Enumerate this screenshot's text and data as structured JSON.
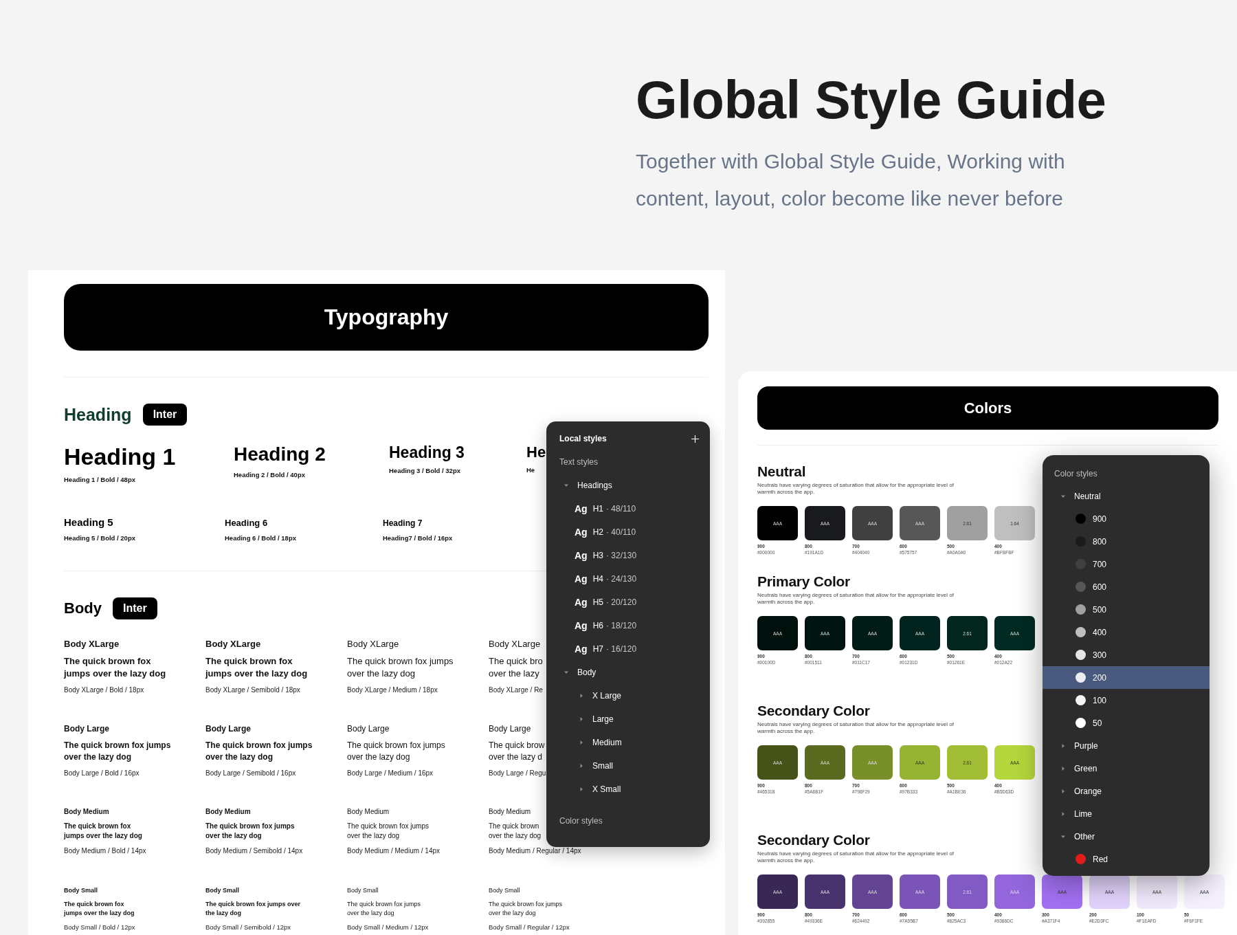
{
  "header": {
    "title": "Global Style Guide",
    "subtitle": "Together with Global Style Guide, Working with content, layout, color become like never before"
  },
  "typography": {
    "title": "Typography",
    "heading_section": {
      "label": "Heading",
      "font": "Inter",
      "rows": [
        [
          {
            "kind": "h1",
            "name": "Heading 1",
            "spec": "Heading 1 / Bold / 48px"
          },
          {
            "kind": "h2",
            "name": "Heading 2",
            "spec": "Heading 2 / Bold / 40px"
          },
          {
            "kind": "h3",
            "name": "Heading 3",
            "spec": "Heading 3 / Bold / 32px"
          },
          {
            "kind": "h4",
            "name": "He",
            "spec": "He"
          }
        ],
        [
          {
            "kind": "h5",
            "name": "Heading 5",
            "spec": "Heading 5 / Bold / 20px"
          },
          {
            "kind": "h6",
            "name": "Heading 6",
            "spec": "Heading 6 / Bold / 18px"
          },
          {
            "kind": "h7",
            "name": "Heading 7",
            "spec": "Heading7 / Bold / 16px"
          }
        ]
      ]
    },
    "body_section": {
      "label": "Body",
      "font": "Inter",
      "rows": [
        {
          "kind": "xlarge",
          "cells": [
            {
              "title": "Body XLarge",
              "sample": "The quick brown fox\njumps over the lazy dog",
              "spec": "Body XLarge / Bold / 18px"
            },
            {
              "title": "Body XLarge",
              "sample": "The quick brown fox\njumps over the lazy dog",
              "spec": "Body XLarge / Semibold / 18px"
            },
            {
              "title": "Body XLarge",
              "sample": "The quick brown fox jumps\nover the lazy dog",
              "spec": "Body XLarge / Medium / 18px"
            },
            {
              "title": "Body XLarge",
              "sample": "The quick bro\nover the lazy",
              "spec": "Body XLarge / Re"
            }
          ]
        },
        {
          "kind": "large",
          "cells": [
            {
              "title": "Body Large",
              "sample": "The quick brown fox jumps\nover the lazy dog",
              "spec": "Body Large / Bold / 16px"
            },
            {
              "title": "Body Large",
              "sample": "The quick brown fox jumps\nover the lazy dog",
              "spec": "Body Large / Semibold / 16px"
            },
            {
              "title": "Body Large",
              "sample": "The quick brown fox jumps\nover the lazy dog",
              "spec": "Body Large / Medium / 16px"
            },
            {
              "title": "Body Large",
              "sample": "The quick brow\nover the lazy d",
              "spec": "Body Large / Regu"
            }
          ]
        },
        {
          "kind": "medium",
          "cells": [
            {
              "title": "Body Medium",
              "sample": "The quick brown fox\njumps over the lazy dog",
              "spec": "Body Medium / Bold / 14px"
            },
            {
              "title": "Body Medium",
              "sample": "The quick brown fox jumps\nover the lazy dog",
              "spec": "Body Medium / Semibold / 14px"
            },
            {
              "title": "Body Medium",
              "sample": "The quick brown fox jumps\nover the lazy dog",
              "spec": "Body Medium / Medium / 14px"
            },
            {
              "title": "Body Medium",
              "sample": "The quick brown\nover the lazy dog",
              "spec": "Body Medium / Regular / 14px"
            }
          ]
        },
        {
          "kind": "small",
          "cells": [
            {
              "title": "Body Small",
              "sample": "The quick brown fox\njumps over the lazy dog",
              "spec": "Body Small / Bold / 12px"
            },
            {
              "title": "Body Small",
              "sample": "The quick brown fox jumps over\nthe lazy dog",
              "spec": "Body Small / Semibold / 12px"
            },
            {
              "title": "Body Small",
              "sample": "The quick brown fox jumps\nover the lazy dog",
              "spec": "Body Small / Medium / 12px"
            },
            {
              "title": "Body Small",
              "sample": "The quick brown fox jumps\nover the lazy dog",
              "spec": "Body Small / Regular / 12px"
            }
          ]
        }
      ]
    }
  },
  "local_styles": {
    "title": "Local styles",
    "sections": [
      {
        "label": "Text styles",
        "groups": [
          {
            "label": "Headings",
            "expanded": true,
            "items": [
              {
                "kind": "text-style",
                "sample": "Ag",
                "name": "H1",
                "size": "· 48/110"
              },
              {
                "kind": "text-style",
                "sample": "Ag",
                "name": "H2",
                "size": "· 40/110"
              },
              {
                "kind": "text-style",
                "sample": "Ag",
                "name": "H3",
                "size": "· 32/130"
              },
              {
                "kind": "text-style",
                "sample": "Ag",
                "name": "H4",
                "size": "· 24/130"
              },
              {
                "kind": "text-style",
                "sample": "Ag",
                "name": "H5",
                "size": "· 20/120"
              },
              {
                "kind": "text-style",
                "sample": "Ag",
                "name": "H6",
                "size": "· 18/120"
              },
              {
                "kind": "text-style",
                "sample": "Ag",
                "name": "H7",
                "size": "· 16/120"
              }
            ]
          },
          {
            "label": "Body",
            "expanded": true,
            "items": [
              {
                "kind": "folder",
                "name": "X Large",
                "expanded": false
              },
              {
                "kind": "folder",
                "name": "Large",
                "expanded": false
              },
              {
                "kind": "folder",
                "name": "Medium",
                "expanded": false
              },
              {
                "kind": "folder",
                "name": "Small",
                "expanded": false
              },
              {
                "kind": "folder",
                "name": "X Small",
                "expanded": false
              }
            ]
          }
        ]
      },
      {
        "label": "Color styles"
      }
    ]
  },
  "colors": {
    "title": "Colors",
    "groups": [
      {
        "title": "Neutral",
        "description": "Neutrals have varying degrees of saturation that allow for the appropriate level of\nwarmth across the app.",
        "swatches": [
          {
            "step": "900",
            "hex": "#000000",
            "color": "#000000",
            "label": "AAA"
          },
          {
            "step": "800",
            "hex": "#191A1D",
            "color": "#191a1d",
            "label": "AAA"
          },
          {
            "step": "700",
            "hex": "#404040",
            "color": "#404040",
            "label": "AAA"
          },
          {
            "step": "600",
            "hex": "#575757",
            "color": "#575757",
            "label": "AAA"
          },
          {
            "step": "500",
            "hex": "#A0A0A0",
            "color": "#a0a0a0",
            "label": "2.61"
          },
          {
            "step": "400",
            "hex": "#BFBFBF",
            "color": "#bfbfbf",
            "label": "1.64"
          }
        ]
      },
      {
        "title": "Primary Color",
        "description": "Neutrals have varying degrees of saturation that allow for the appropriate level of\nwarmth across the app.",
        "swatches": [
          {
            "step": "900",
            "hex": "#00100D",
            "color": "#00100d",
            "label": "AAA"
          },
          {
            "step": "800",
            "hex": "#001511",
            "color": "#001511",
            "label": "AAA"
          },
          {
            "step": "700",
            "hex": "#011C17",
            "color": "#011c17",
            "label": "AAA"
          },
          {
            "step": "600",
            "hex": "#01231D",
            "color": "#01231d",
            "label": "AAA"
          },
          {
            "step": "500",
            "hex": "#01261E",
            "color": "#01261e",
            "label": "2.61"
          },
          {
            "step": "400",
            "hex": "#012A22",
            "color": "#012a22",
            "label": "AAA"
          }
        ]
      },
      {
        "title": "Secondary Color",
        "description": "Neutrals have varying degrees of saturation that allow for the appropriate level of\nwarmth across the app.",
        "swatches": [
          {
            "step": "900",
            "hex": "#465318",
            "color": "#465318",
            "label": "AAA"
          },
          {
            "step": "800",
            "hex": "#5A6B1F",
            "color": "#5a6b1f",
            "label": "AAA"
          },
          {
            "step": "700",
            "hex": "#798F29",
            "color": "#798f29",
            "label": "AAA"
          },
          {
            "step": "600",
            "hex": "#97B333",
            "color": "#97b333",
            "label": "AAA"
          },
          {
            "step": "500",
            "hex": "#A1BE36",
            "color": "#a1be36",
            "label": "2.61"
          },
          {
            "step": "400",
            "hex": "#B5D63D",
            "color": "#b5d63d",
            "label": "AAA"
          }
        ]
      },
      {
        "title": "Secondary Color",
        "description": "Neutrals have varying degrees of saturation that allow for the appropriate level of\nwarmth across the app.",
        "swatches": [
          {
            "step": "900",
            "hex": "#392855",
            "color": "#392855",
            "label": "AAA"
          },
          {
            "step": "800",
            "hex": "#49336E",
            "color": "#49336e",
            "label": "AAA"
          },
          {
            "step": "700",
            "hex": "#624492",
            "color": "#624492",
            "label": "AAA"
          },
          {
            "step": "600",
            "hex": "#7A55B7",
            "color": "#7a55b7",
            "label": "AAA"
          },
          {
            "step": "500",
            "hex": "#825AC3",
            "color": "#825ac3",
            "label": "2.61"
          },
          {
            "step": "400",
            "hex": "#9366DC",
            "color": "#9366dc",
            "label": "AAA"
          },
          {
            "step": "300",
            "hex": "#A371F4",
            "color": "#a371f4",
            "label": "AAA"
          },
          {
            "step": "200",
            "hex": "#E2D3FC",
            "color": "#e2d3fc",
            "label": "AAA"
          },
          {
            "step": "100",
            "hex": "#F1EAFD",
            "color": "#f1eafd",
            "label": "AAA"
          },
          {
            "step": "50",
            "hex": "#F6F1FE",
            "color": "#f6f1fe",
            "label": "AAA"
          }
        ]
      }
    ]
  },
  "color_styles": {
    "title": "Color styles",
    "groups": [
      {
        "label": "Neutral",
        "expanded": true,
        "items": [
          {
            "name": "900",
            "color": "#000000",
            "selected": false
          },
          {
            "name": "800",
            "color": "#1a1b1d",
            "selected": false
          },
          {
            "name": "700",
            "color": "#404040",
            "selected": false
          },
          {
            "name": "600",
            "color": "#575757",
            "selected": false
          },
          {
            "name": "500",
            "color": "#a0a0a0",
            "selected": false
          },
          {
            "name": "400",
            "color": "#bfbfbf",
            "selected": false
          },
          {
            "name": "300",
            "color": "#e5e5e5",
            "selected": false
          },
          {
            "name": "200",
            "color": "#eeeef2",
            "selected": true
          },
          {
            "name": "100",
            "color": "#f5f5f5",
            "selected": false
          },
          {
            "name": "50",
            "color": "#ffffff",
            "selected": false
          }
        ]
      },
      {
        "label": "Purple",
        "expanded": false
      },
      {
        "label": "Green",
        "expanded": false
      },
      {
        "label": "Orange",
        "expanded": false
      },
      {
        "label": "Lime",
        "expanded": false
      },
      {
        "label": "Other",
        "expanded": true,
        "items": [
          {
            "name": "Red",
            "color": "#e31b1b",
            "selected": false
          }
        ]
      }
    ]
  }
}
